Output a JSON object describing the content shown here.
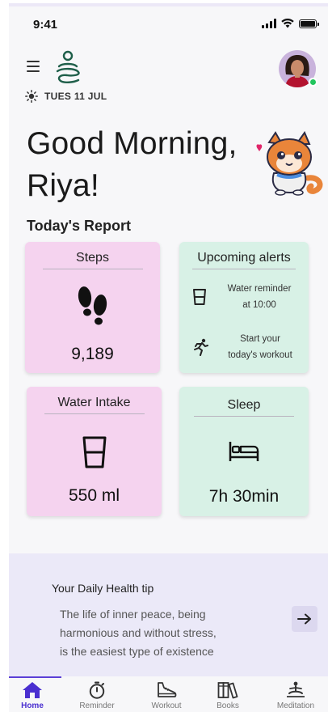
{
  "status": {
    "time": "9:41"
  },
  "header": {
    "date": "TUES 11 JUL"
  },
  "greeting": {
    "line1": "Good Morning,",
    "line2": "Riya!"
  },
  "report": {
    "title": "Today's Report",
    "steps": {
      "title": "Steps",
      "value": "9,189"
    },
    "alerts": {
      "title": "Upcoming alerts",
      "items": [
        {
          "line1": "Water reminder",
          "line2": "at 10:00"
        },
        {
          "line1": "Start your",
          "line2": "today's workout"
        }
      ]
    },
    "water": {
      "title": "Water Intake",
      "value": "550 ml"
    },
    "sleep": {
      "title": "Sleep",
      "value": "7h 30min"
    }
  },
  "tip": {
    "title": "Your Daily Health tip",
    "line1": "The life of inner peace, being",
    "line2": "harmonious and without stress,",
    "line3": "is the easiest type of existence"
  },
  "nav": {
    "items": [
      {
        "label": "Home"
      },
      {
        "label": "Reminder"
      },
      {
        "label": "Workout"
      },
      {
        "label": "Books"
      },
      {
        "label": "Meditation"
      }
    ]
  },
  "colors": {
    "accent": "#4a2fd0",
    "card_pink": "#f5d3ef",
    "card_green": "#d8f1e6",
    "tip_bg": "#ebe9f8",
    "online": "#22c55e"
  }
}
